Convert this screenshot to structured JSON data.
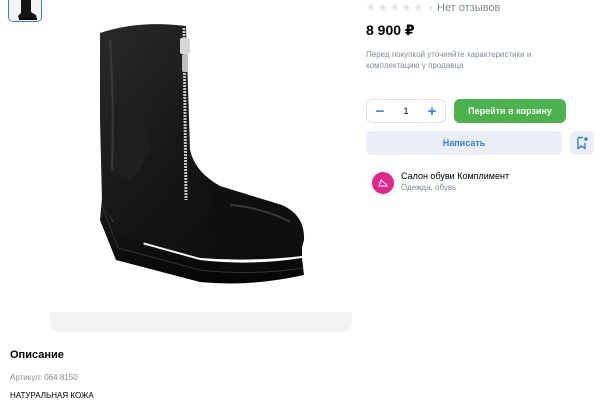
{
  "product": {
    "rating_stars": 5,
    "rating_filled": 0,
    "rating_separator": "·",
    "reviews_text": "Нет отзывов",
    "price": "8 900 ₽",
    "notice": "Перед покупкой уточняйте характеристики и комплектацию у продавца",
    "image_icon": "ankle-boot-black-zip"
  },
  "purchase": {
    "minus_label": "−",
    "quantity": "1",
    "plus_label": "+",
    "cart_label": "Перейти в корзину",
    "write_label": "Написать",
    "bookmark_icon": "bookmark-plus-icon"
  },
  "seller": {
    "name": "Салон обуви Комплимент",
    "category": "Одежда, обувь",
    "avatar_color": "#e2268a"
  },
  "description": {
    "title": "Описание",
    "article": "Артикул: 064 8150",
    "material": "НАТУРАЛЬНАЯ КОЖА"
  },
  "colors": {
    "accent": "#2d81e0",
    "cart_button": "#4bb34b",
    "secondary_button": "#eaeef5",
    "muted_text": "#818c99"
  }
}
